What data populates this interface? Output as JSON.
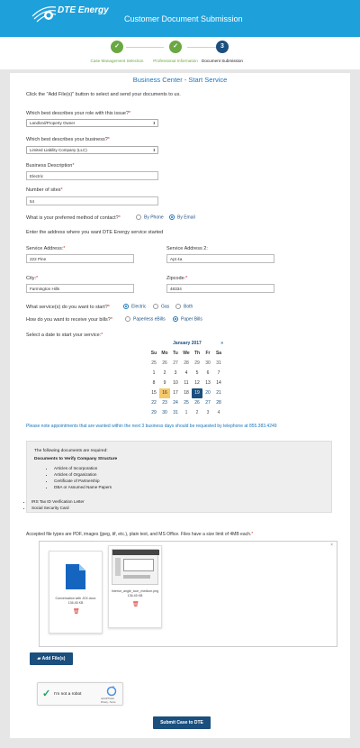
{
  "header": {
    "brand": "DTE Energy",
    "title": "Customer Document Submission",
    "color": "#1ea1db"
  },
  "steps": [
    {
      "label": "Case Management Selection",
      "status": "done",
      "symbol": "✓"
    },
    {
      "label": "Professional Information",
      "status": "done",
      "symbol": "✓"
    },
    {
      "label": "Document Submission",
      "status": "active",
      "symbol": "3"
    }
  ],
  "form": {
    "title": "Business Center - Start Service",
    "intro": "Click the \"Add File(s)\" button to select and send your documents to us.",
    "role_label": "Which best describes your role with this issue?",
    "role_value": "Landlord/Property Owner",
    "business_label": "Which best describes your business?",
    "business_value": "Limited Liability Company (LLC)",
    "desc_label": "Business Description",
    "desc_value": "Electric",
    "sites_label": "Number of sites",
    "sites_value": "54",
    "contact_label": "What is your preferred method of contact?",
    "contact_options": [
      "By Phone",
      "By Email"
    ],
    "contact_selected": "By Email",
    "address_intro": "Enter the address where you want DTE Energy service started",
    "address_label": "Service Address:",
    "address_value": "222 Pine",
    "address2_label": "Service Address 2:",
    "address2_value": "Apt 4a",
    "city_label": "City:",
    "city_value": "Farmington Hills",
    "zip_label": "Zipcode:",
    "zip_value": "48334",
    "services_label": "What service(s) do you want to start?",
    "services_options": [
      "Electric",
      "Gas",
      "Both"
    ],
    "services_selected": "Electric",
    "bills_label": "How do you want to receive your bills?",
    "bills_options": [
      "Paperless eBills",
      "Paper Bills"
    ],
    "bills_selected": "Paper Bills",
    "date_label": "Select a date to start your service:",
    "required_mark": "*"
  },
  "calendar": {
    "month": "January 2017",
    "next": "»",
    "days": [
      "Su",
      "Mo",
      "Tu",
      "We",
      "Th",
      "Fr",
      "Sa"
    ],
    "weeks": [
      [
        "25",
        "26",
        "27",
        "28",
        "29",
        "30",
        "31"
      ],
      [
        "1",
        "2",
        "3",
        "4",
        "5",
        "6",
        "7"
      ],
      [
        "8",
        "9",
        "10",
        "11",
        "12",
        "13",
        "14"
      ],
      [
        "15",
        "16",
        "17",
        "18",
        "19",
        "20",
        "21"
      ],
      [
        "22",
        "23",
        "24",
        "25",
        "26",
        "27",
        "28"
      ],
      [
        "29",
        "30",
        "31",
        "1",
        "2",
        "3",
        "4"
      ]
    ],
    "today": "16",
    "selected": "19"
  },
  "notice": "Please note appointments that are wanted within the next 3 business days should be requested by telephone at 855.383.4249",
  "documents": {
    "intro": "The following documents are required:",
    "heading": "Documents to Verify Company Structure",
    "structure_items": [
      "Articles of Incorporation",
      "Articles of Organization",
      "Certificate of Partnership",
      "DBA or Assumed Name Papers"
    ],
    "other_items": [
      "IRS Tax ID Verification Letter",
      "Social Security Card"
    ]
  },
  "upload": {
    "note": "Accepted file types are PDF, images (jpeg, tif, etc.), plain text, and MS Office. Files have a size limit of 4MB each.",
    "files": [
      {
        "name": "Conversation with JCK.docx",
        "size": "136.45 KB"
      },
      {
        "name": "Interior_angle_icon_medium.png",
        "size": "136.45 KB"
      }
    ],
    "add_button": "Add File(s)"
  },
  "captcha": {
    "label": "I'm not a robot",
    "brand": "reCAPTCHA",
    "links": "Privacy - Terms"
  },
  "submit_button": "Submit Case to DTE"
}
